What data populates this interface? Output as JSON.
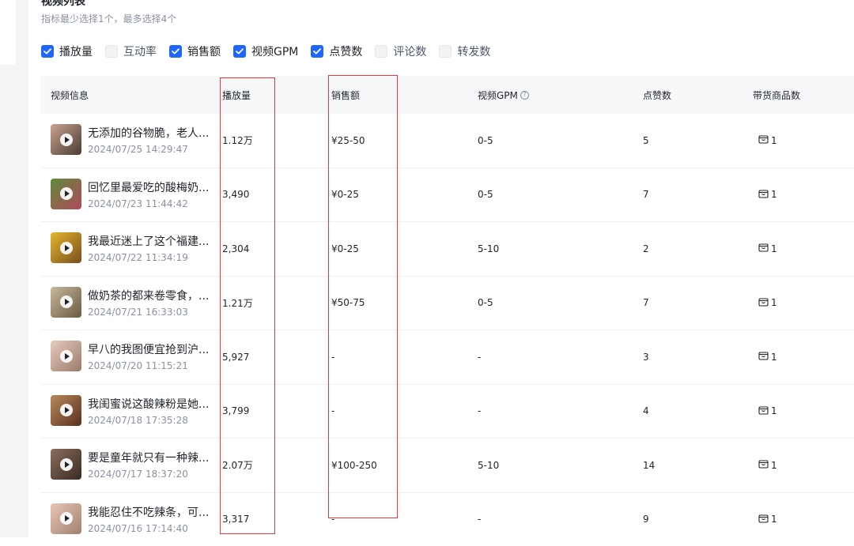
{
  "section": {
    "title": "视频列表",
    "hint": "指标最少选择1个，最多选择4个"
  },
  "metrics": [
    {
      "label": "播放量",
      "checked": true
    },
    {
      "label": "互动率",
      "checked": false
    },
    {
      "label": "销售额",
      "checked": true
    },
    {
      "label": "视频GPM",
      "checked": true
    },
    {
      "label": "点赞数",
      "checked": true
    },
    {
      "label": "评论数",
      "checked": false
    },
    {
      "label": "转发数",
      "checked": false
    }
  ],
  "table": {
    "columns": [
      "视频信息",
      "播放量",
      "销售额",
      "视频GPM",
      "点赞数",
      "带货商品数"
    ],
    "rows": [
      {
        "title": "无添加的谷物脆，老人...",
        "date": "2024/07/25 14:29:47",
        "plays": "1.12万",
        "sales": "¥25-50",
        "gpm": "0-5",
        "likes": "5",
        "goods": "1",
        "thumb_colors": [
          "#c9a48e",
          "#4a3a34"
        ]
      },
      {
        "title": "回忆里最爱吃的酸梅奶...",
        "date": "2024/07/23 11:44:42",
        "plays": "3,490",
        "sales": "¥0-25",
        "gpm": "0-5",
        "likes": "7",
        "goods": "1",
        "thumb_colors": [
          "#5f8a3c",
          "#b0495a"
        ]
      },
      {
        "title": "我最近迷上了这个福建...",
        "date": "2024/07/22 11:34:19",
        "plays": "2,304",
        "sales": "¥0-25",
        "gpm": "5-10",
        "likes": "2",
        "goods": "1",
        "thumb_colors": [
          "#e2b62c",
          "#7a4e1e"
        ]
      },
      {
        "title": "做奶茶的都来卷零食，...",
        "date": "2024/07/21 16:33:03",
        "plays": "1.21万",
        "sales": "¥50-75",
        "gpm": "0-5",
        "likes": "7",
        "goods": "1",
        "thumb_colors": [
          "#c8b89a",
          "#6b5a44"
        ]
      },
      {
        "title": "早八的我图便宜抢到沪...",
        "date": "2024/07/20 11:15:21",
        "plays": "5,927",
        "sales": "-",
        "gpm": "-",
        "likes": "3",
        "goods": "1",
        "thumb_colors": [
          "#e7cbbd",
          "#9b7a6a"
        ]
      },
      {
        "title": "我闺蜜说这酸辣粉是她...",
        "date": "2024/07/18 17:35:28",
        "plays": "3,799",
        "sales": "-",
        "gpm": "-",
        "likes": "4",
        "goods": "1",
        "thumb_colors": [
          "#b88a5e",
          "#5a2e1c"
        ]
      },
      {
        "title": "要是童年就只有一种辣...",
        "date": "2024/07/17 18:37:20",
        "plays": "2.07万",
        "sales": "¥100-250",
        "gpm": "5-10",
        "likes": "14",
        "goods": "1",
        "thumb_colors": [
          "#8a6e5a",
          "#3a2a24"
        ]
      },
      {
        "title": "我能忍住不吃辣条，可...",
        "date": "2024/07/16 17:14:40",
        "plays": "3,317",
        "sales": "-",
        "gpm": "-",
        "likes": "9",
        "goods": "1",
        "thumb_colors": [
          "#e8c6b8",
          "#a0806e"
        ]
      }
    ]
  },
  "colors": {
    "accent": "#1e66ff",
    "highlight_box": "#e5383b"
  }
}
